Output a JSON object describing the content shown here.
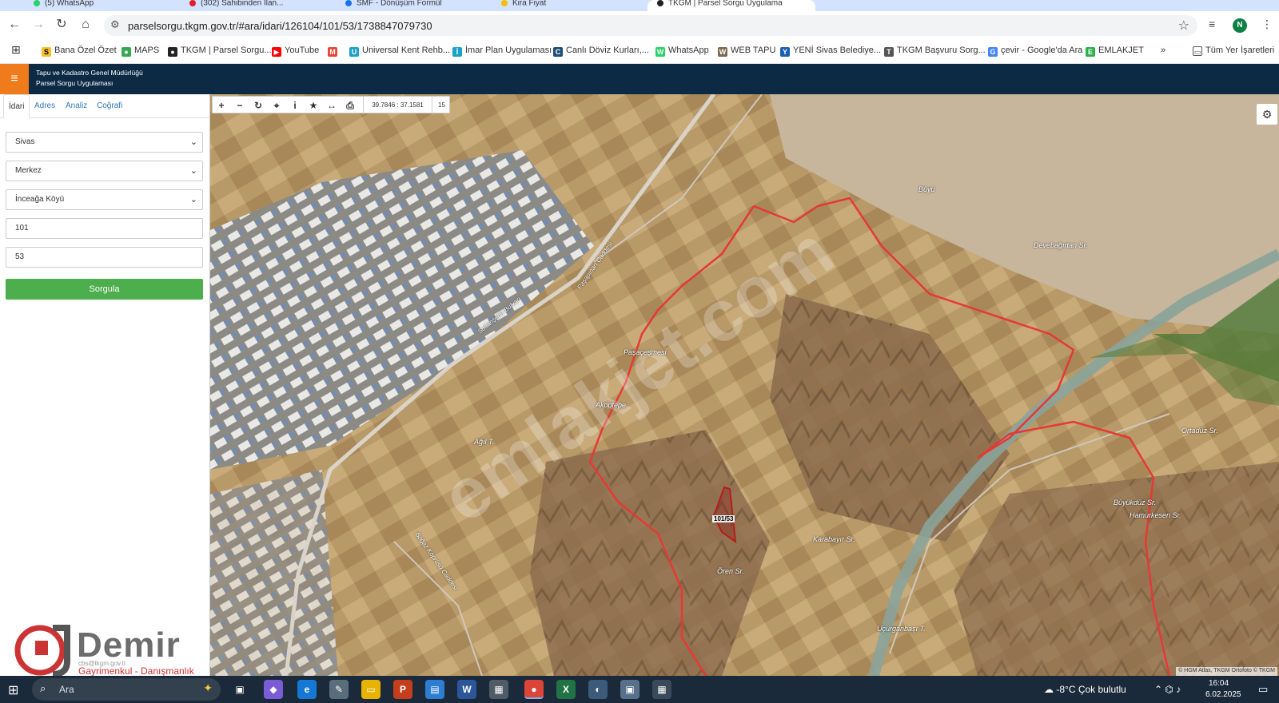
{
  "browser": {
    "tabs": [
      {
        "label": "(5) WhatsApp",
        "color": "#25d366"
      },
      {
        "label": "(302) Sahibinden İlan...",
        "color": "#e21b30"
      },
      {
        "label": "SMF - Dönüşüm Formül",
        "color": "#1a73e8"
      },
      {
        "label": "Kira Fiyat",
        "color": "#fbbc04"
      },
      {
        "label": "TKGM | Parsel Sorgu Uygulama",
        "color": "#222"
      }
    ],
    "url": "parselsorgu.tkgm.gov.tr/#ara/idari/126104/101/53/1738847079730",
    "profile_initial": "N",
    "bookmarks": [
      {
        "label": "Bana Özel Özet",
        "icon_color": "#f6c026",
        "icon": "S"
      },
      {
        "label": "MAPS",
        "icon_color": "#34a853",
        "icon": "●"
      },
      {
        "label": "TKGM | Parsel Sorgu...",
        "icon_color": "#222",
        "icon": "●"
      },
      {
        "label": "YouTube",
        "icon_color": "#ff0000",
        "icon": "▶"
      },
      {
        "label": "",
        "icon_color": "#ea4335",
        "icon": "M"
      },
      {
        "label": "Universal Kent Rehb...",
        "icon_color": "#1aa3c8",
        "icon": "U"
      },
      {
        "label": "İmar Plan Uygulaması",
        "icon_color": "#1aa3c8",
        "icon": "İ"
      },
      {
        "label": "Canlı Döviz Kurları,...",
        "icon_color": "#1f4e79",
        "icon": "C"
      },
      {
        "label": "WhatsApp",
        "icon_color": "#25d366",
        "icon": "W"
      },
      {
        "label": "WEB TAPU",
        "icon_color": "#7a6a4f",
        "icon": "W"
      },
      {
        "label": "YENİ Sivas Belediye...",
        "icon_color": "#1a5fb4",
        "icon": "Y"
      },
      {
        "label": "TKGM Başvuru Sorg...",
        "icon_color": "#555",
        "icon": "T"
      },
      {
        "label": "çevir - Google'da Ara",
        "icon_color": "#4285f4",
        "icon": "G"
      },
      {
        "label": "EMLAKJET",
        "icon_color": "#2bb24c",
        "icon": "E"
      }
    ],
    "more_bookmarks": "»",
    "all_bookmarks": "Tüm Yer İşaretleri"
  },
  "app": {
    "title_line1": "Tapu ve Kadastro Genel Müdürlüğü",
    "title_line2": "Parsel Sorgu Uygulaması"
  },
  "panel": {
    "tabs": [
      "İdari",
      "Adres",
      "Analiz",
      "Coğrafi"
    ],
    "province": "Sivas",
    "district": "Merkez",
    "village": "İnceağa Köyü",
    "block": "101",
    "parcel": "53",
    "query_button": "Sorgula"
  },
  "map": {
    "coordinates": "39.7846 : 37.1581",
    "zoom": "15",
    "attribution": "© HGM Atlas, TKGM Ortofoto © TKGM",
    "parcel_label": "101/53",
    "places": [
      {
        "name": "Büyü"
      },
      {
        "name": "Devebağırtan Sr."
      },
      {
        "name": "Paşaçeşmesi"
      },
      {
        "name": "Akoptepe"
      },
      {
        "name": "Ağıl T."
      },
      {
        "name": "Ortadüz Sr."
      },
      {
        "name": "Büyükdüz Sr."
      },
      {
        "name": "Hamurkesen Sr."
      },
      {
        "name": "Karabayır Sr."
      },
      {
        "name": "Ören Sr."
      },
      {
        "name": "Uçurganbaşı T."
      },
      {
        "name": "Sultanşehir Bulvarı"
      },
      {
        "name": "Boğaz Köprüsü Caddesi"
      },
      {
        "name": "Paşapınarı Caddesi"
      }
    ],
    "watermark": "emlakjet.com"
  },
  "logo": {
    "name": "Demir",
    "subtitle": "Gayrimenkul - Danışmanlık",
    "tiny": "cbs@tkgm.gov.tr"
  },
  "taskbar": {
    "search_placeholder": "Ara",
    "weather": "-8°C  Çok bulutlu",
    "time": "16:04",
    "date": "6.02.2025"
  }
}
